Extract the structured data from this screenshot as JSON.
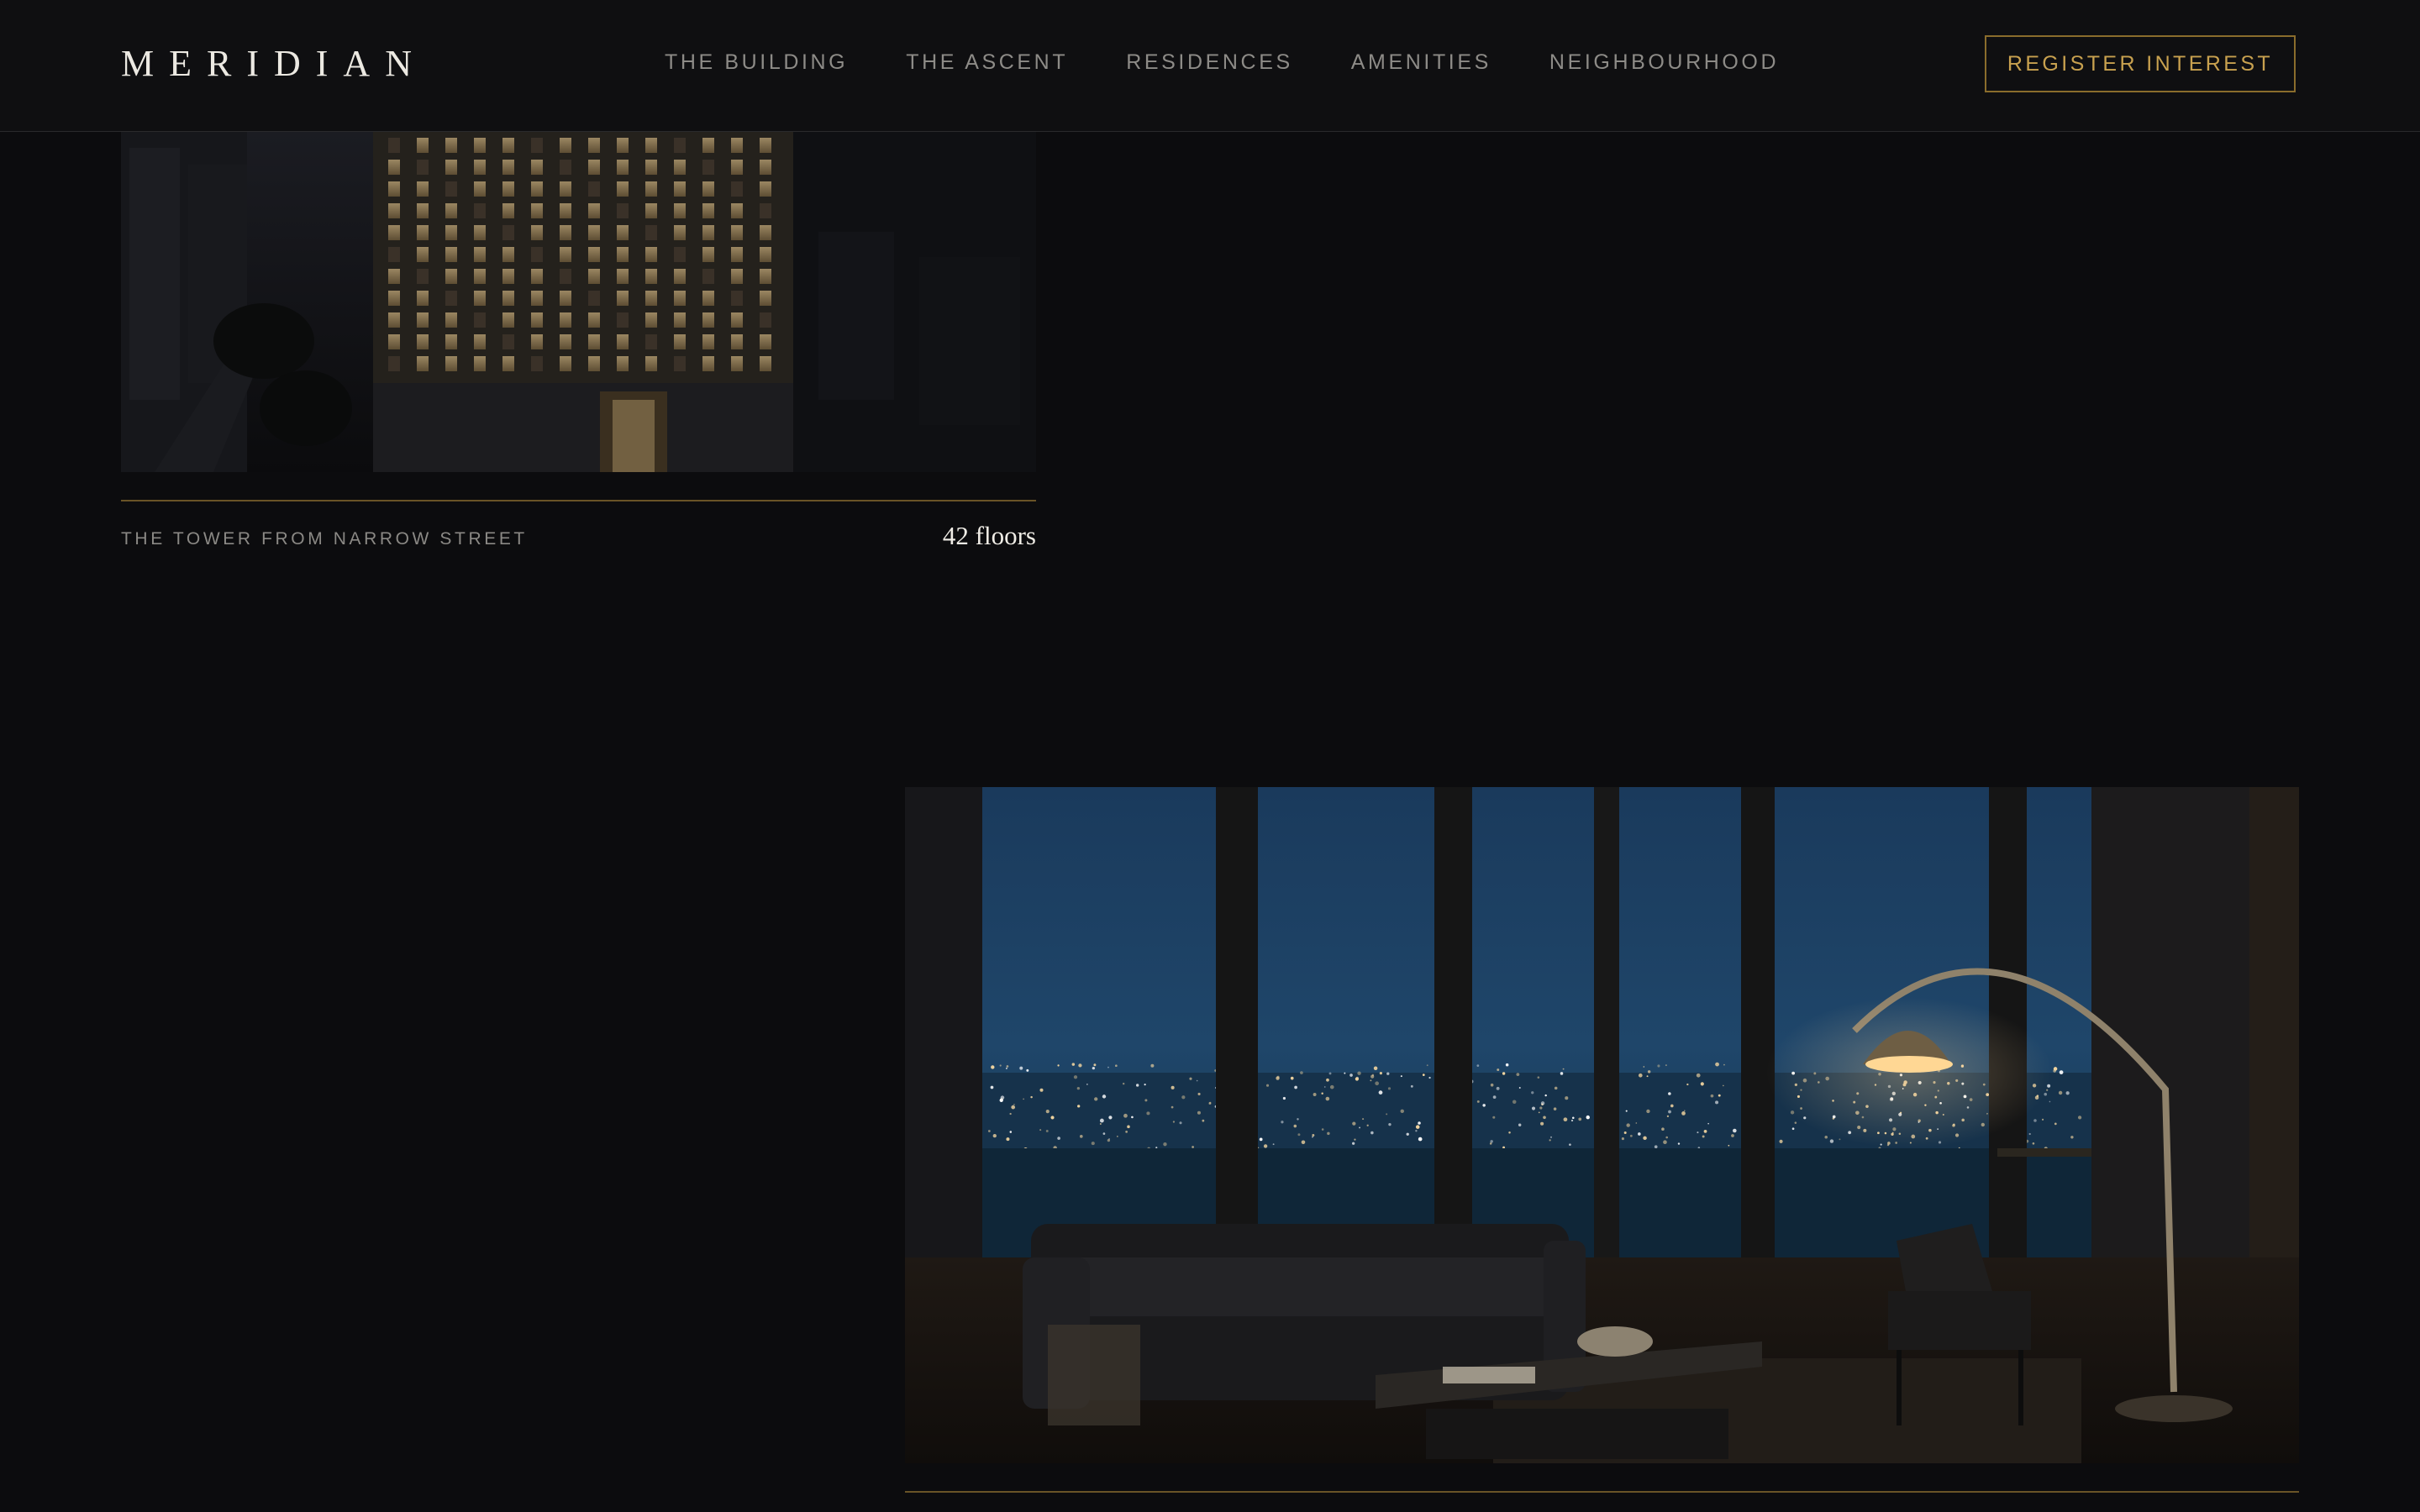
{
  "header": {
    "logo": "MERIDIAN",
    "nav": [
      {
        "label": "THE BUILDING"
      },
      {
        "label": "THE ASCENT"
      },
      {
        "label": "RESIDENCES"
      },
      {
        "label": "AMENITIES"
      },
      {
        "label": "NEIGHBOURHOOD"
      }
    ],
    "cta_label": "REGISTER INTEREST"
  },
  "tower": {
    "caption": "THE TOWER FROM NARROW STREET",
    "floors": "42 floors"
  },
  "colors": {
    "background": "#0c0c0e",
    "accent_gold": "#c8a14f",
    "rule_gold": "#6a5427"
  }
}
